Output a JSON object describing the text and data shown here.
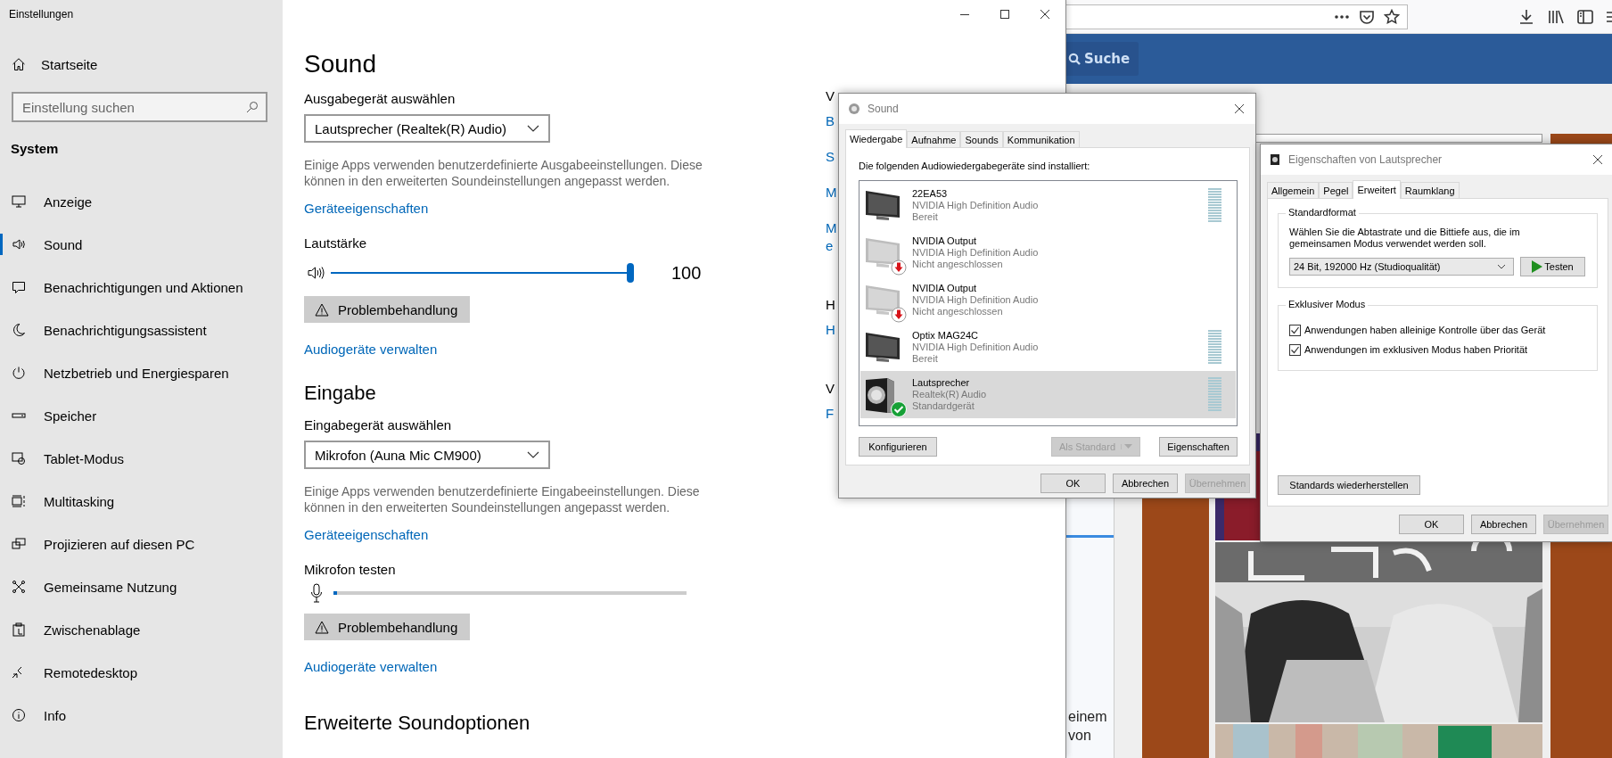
{
  "settings": {
    "title": "Einstellungen",
    "sidebar": {
      "home": "Startseite",
      "search_placeholder": "Einstellung suchen",
      "section": "System",
      "items": [
        {
          "label": "Anzeige",
          "selected": false
        },
        {
          "label": "Sound",
          "selected": true
        },
        {
          "label": "Benachrichtigungen und Aktionen",
          "selected": false
        },
        {
          "label": "Benachrichtigungsassistent",
          "selected": false
        },
        {
          "label": "Netzbetrieb und Energiesparen",
          "selected": false
        },
        {
          "label": "Speicher",
          "selected": false
        },
        {
          "label": "Tablet-Modus",
          "selected": false
        },
        {
          "label": "Multitasking",
          "selected": false
        },
        {
          "label": "Projizieren auf diesen PC",
          "selected": false
        },
        {
          "label": "Gemeinsame Nutzung",
          "selected": false
        },
        {
          "label": "Zwischenablage",
          "selected": false
        },
        {
          "label": "Remotedesktop",
          "selected": false
        },
        {
          "label": "Info",
          "selected": false
        }
      ]
    },
    "page": {
      "title": "Sound",
      "sections": [
        {
          "kind": "output",
          "label": "Ausgabegerät auswählen",
          "device": "Lautsprecher (Realtek(R) Audio)",
          "note": "Einige Apps verwenden benutzerdefinierte Ausgabeeinstellungen. Diese können in den erweiterten Soundeinstellungen angepasst werden.",
          "link": "Geräteeigenschaften",
          "meter_label": "Lautstärke",
          "level": 1.0,
          "reading": "100",
          "troubleshoot": "Problembehandlung",
          "manage": "Audiogeräte verwalten"
        },
        {
          "kind": "input",
          "heading": "Eingabe",
          "label": "Eingabegerät auswählen",
          "device": "Mikrofon (Auna Mic CM900)",
          "note": "Einige Apps verwenden benutzerdefinierte Eingabeeinstellungen. Diese können in den erweiterten Soundeinstellungen angepasst werden.",
          "link": "Geräteeigenschaften",
          "meter_label": "Mikrofon testen",
          "level": 0.01,
          "troubleshoot": "Problembehandlung",
          "manage": "Audiogeräte verwalten"
        }
      ],
      "advanced_heading": "Erweiterte Soundoptionen"
    },
    "related_fragments": [
      {
        "text": "V",
        "kind": "heading"
      },
      {
        "text": "B",
        "kind": "link"
      },
      {
        "text": "S",
        "kind": "link"
      },
      {
        "text": "M",
        "kind": "link"
      },
      {
        "text": "M e",
        "kind": "link"
      },
      {
        "text": "H",
        "kind": "heading"
      },
      {
        "text": "H",
        "kind": "link"
      },
      {
        "text": "V",
        "kind": "heading"
      },
      {
        "text": "F",
        "kind": "link"
      }
    ]
  },
  "sound_dialog": {
    "title": "Sound",
    "tabs": [
      {
        "label": "Wiedergabe",
        "selected": true
      },
      {
        "label": "Aufnahme",
        "selected": false
      },
      {
        "label": "Sounds",
        "selected": false
      },
      {
        "label": "Kommunikation",
        "selected": false
      }
    ],
    "intro": "Die folgenden Audiowiedergabegeräte sind installiert:",
    "devices": [
      {
        "kind": "monitor",
        "name": "22EA53",
        "driver": "NVIDIA High Definition Audio",
        "status": "Bereit",
        "unplugged": false,
        "is_default": false,
        "meter": true,
        "selected": false
      },
      {
        "kind": "monitor",
        "name": "NVIDIA Output",
        "driver": "NVIDIA High Definition Audio",
        "status": "Nicht angeschlossen",
        "unplugged": true,
        "is_default": false,
        "meter": false,
        "selected": false
      },
      {
        "kind": "monitor",
        "name": "NVIDIA Output",
        "driver": "NVIDIA High Definition Audio",
        "status": "Nicht angeschlossen",
        "unplugged": true,
        "is_default": false,
        "meter": false,
        "selected": false
      },
      {
        "kind": "monitor",
        "name": "Optix MAG24C",
        "driver": "NVIDIA High Definition Audio",
        "status": "Bereit",
        "unplugged": false,
        "is_default": false,
        "meter": true,
        "selected": false
      },
      {
        "kind": "speaker",
        "name": "Lautsprecher",
        "driver": "Realtek(R) Audio",
        "status": "Standardgerät",
        "unplugged": false,
        "is_default": true,
        "meter": true,
        "selected": true
      }
    ],
    "list_buttons": [
      {
        "kind": "plain",
        "label": "Konfigurieren",
        "disabled": false
      },
      {
        "kind": "split",
        "label": "Als Standard",
        "disabled": true
      },
      {
        "kind": "plain",
        "label": "Eigenschaften",
        "disabled": false
      }
    ],
    "buttons": [
      {
        "label": "OK",
        "disabled": false
      },
      {
        "label": "Abbrechen",
        "disabled": false
      },
      {
        "label": "Übernehmen",
        "disabled": true
      }
    ]
  },
  "properties_dialog": {
    "title": "Eigenschaften von Lautsprecher",
    "tabs": [
      {
        "label": "Allgemein",
        "selected": false
      },
      {
        "label": "Pegel",
        "selected": false
      },
      {
        "label": "Erweitert",
        "selected": true
      },
      {
        "label": "Raumklang",
        "selected": false
      }
    ],
    "format_group": {
      "legend": "Standardformat",
      "text": "Wählen Sie die Abtastrate und die Bittiefe aus, die im gemeinsamen Modus verwendet werden soll.",
      "format": "24 Bit, 192000 Hz (Studioqualität)",
      "test_button": "Testen"
    },
    "exclusive_group": {
      "legend": "Exklusiver Modus",
      "options": [
        {
          "label": "Anwendungen haben alleinige Kontrolle über das Gerät",
          "checked": true
        },
        {
          "label": "Anwendungen im exklusiven Modus haben Priorität",
          "checked": true
        }
      ]
    },
    "restore_button": "Standards wiederherstellen",
    "buttons": [
      {
        "label": "OK",
        "disabled": false
      },
      {
        "label": "Abbrechen",
        "disabled": false
      },
      {
        "label": "Übernehmen",
        "disabled": true
      }
    ]
  },
  "browser": {
    "search_button": "Suche",
    "snippet_lines": [
      "einem",
      "von"
    ]
  }
}
